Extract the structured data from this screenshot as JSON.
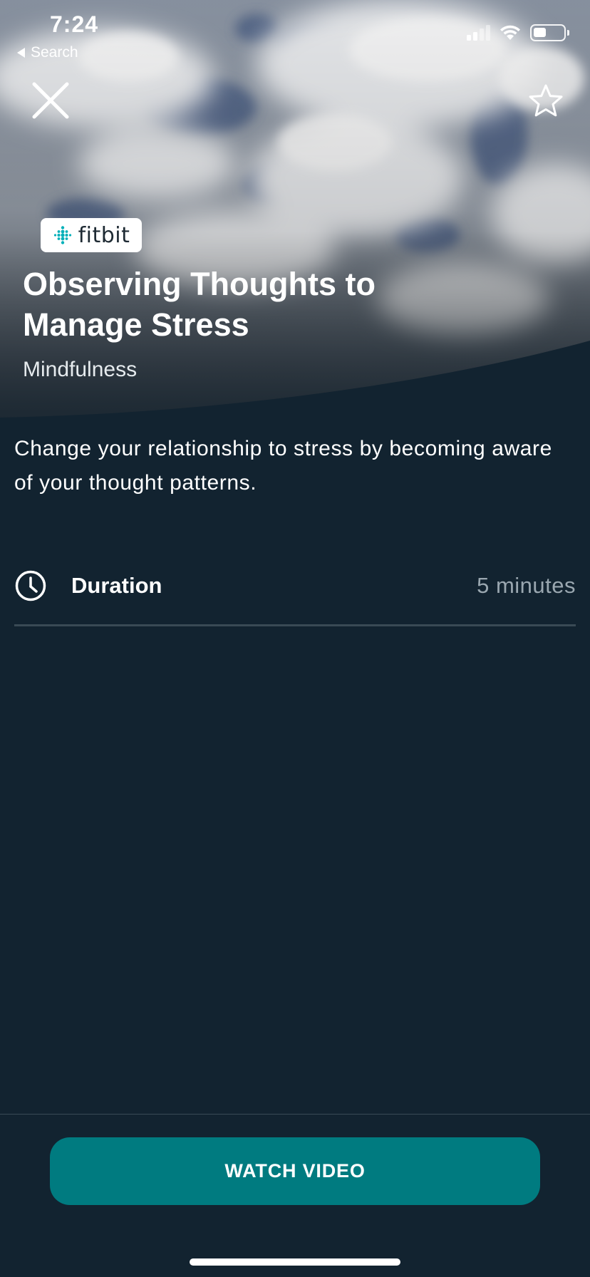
{
  "status_bar": {
    "time": "7:24",
    "back_label": "Search"
  },
  "hero": {
    "brand": "fitbit",
    "title": "Observing Thoughts to Manage Stress",
    "category": "Mindfulness"
  },
  "description": "Change your relationship to stress by becoming aware of your thought patterns.",
  "duration": {
    "label": "Duration",
    "value": "5 minutes"
  },
  "actions": {
    "watch_video_label": "WATCH VIDEO"
  },
  "colors": {
    "background": "#122330",
    "accent": "#007b80",
    "brand_teal": "#00b0b9"
  },
  "icons": {
    "close": "close-icon",
    "favorite": "star-outline-icon",
    "duration": "clock-icon",
    "brand": "fitbit-dots-icon"
  }
}
